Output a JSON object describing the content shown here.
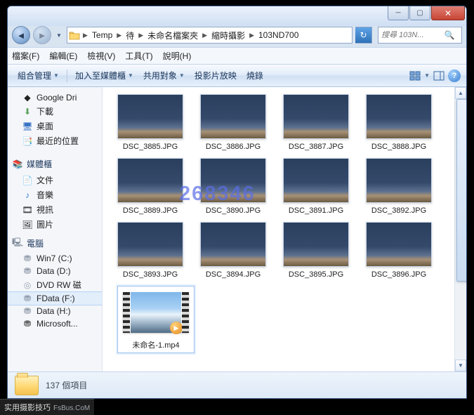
{
  "breadcrumb": [
    "Temp",
    "待",
    "未命名檔案夾",
    "縮時攝影",
    "103ND700"
  ],
  "search": {
    "placeholder": "搜尋 103N..."
  },
  "menu": {
    "file": "檔案(F)",
    "edit": "編輯(E)",
    "view": "檢視(V)",
    "tools": "工具(T)",
    "help": "說明(H)"
  },
  "cmd": {
    "organize": "組合管理",
    "include": "加入至媒體櫃",
    "share": "共用對象",
    "slideshow": "投影片放映",
    "burn": "燒錄"
  },
  "sidebar": {
    "favorites": {
      "items": [
        {
          "label": "Google Dri"
        },
        {
          "label": "下載"
        },
        {
          "label": "桌面"
        },
        {
          "label": "最近的位置"
        }
      ]
    },
    "libraries": {
      "title": "媒體櫃",
      "items": [
        {
          "label": "文件"
        },
        {
          "label": "音樂"
        },
        {
          "label": "視訊"
        },
        {
          "label": "圖片"
        }
      ]
    },
    "computer": {
      "title": "電腦",
      "items": [
        {
          "label": "Win7 (C:)"
        },
        {
          "label": "Data (D:)"
        },
        {
          "label": "DVD RW 磁"
        },
        {
          "label": "FData (F:)"
        },
        {
          "label": "Data (H:)"
        },
        {
          "label": "Microsoft..."
        }
      ]
    }
  },
  "files": [
    {
      "name": "DSC_3885.JPG"
    },
    {
      "name": "DSC_3886.JPG"
    },
    {
      "name": "DSC_3887.JPG"
    },
    {
      "name": "DSC_3888.JPG"
    },
    {
      "name": "DSC_3889.JPG"
    },
    {
      "name": "DSC_3890.JPG"
    },
    {
      "name": "DSC_3891.JPG"
    },
    {
      "name": "DSC_3892.JPG"
    },
    {
      "name": "DSC_3893.JPG"
    },
    {
      "name": "DSC_3894.JPG"
    },
    {
      "name": "DSC_3895.JPG"
    },
    {
      "name": "DSC_3896.JPG"
    }
  ],
  "video": {
    "name": "未命名-1.mp4"
  },
  "status": {
    "text": "137 個項目"
  },
  "watermark": "268346",
  "site": {
    "name": "实用摄影技巧",
    "domain": "FsBus.CoM"
  }
}
